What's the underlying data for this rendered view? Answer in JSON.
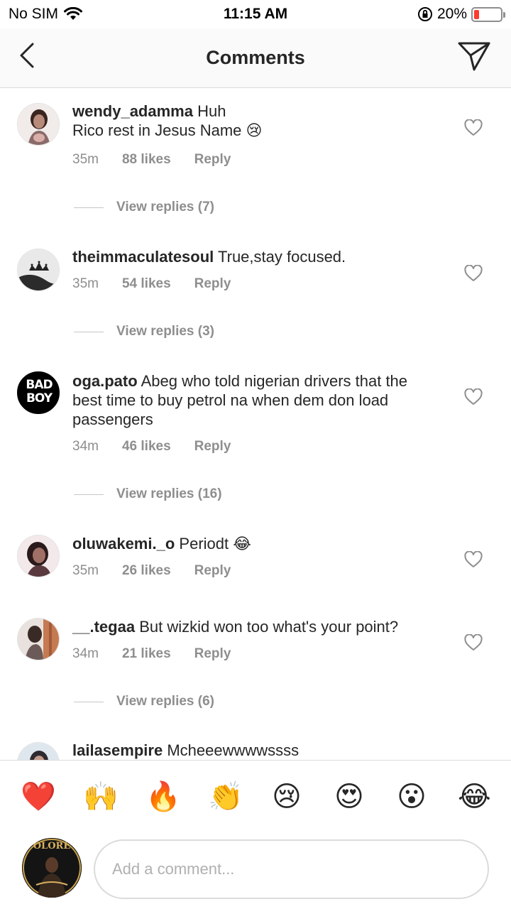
{
  "status_bar": {
    "carrier": "No SIM",
    "time": "11:15 AM",
    "battery_percent": "20%",
    "battery_level": 0.2
  },
  "header": {
    "title": "Comments"
  },
  "comments": [
    {
      "username": "wendy_adamma",
      "text": "Huh\nRico rest in Jesus Name",
      "emoji": "😢",
      "time": "35m",
      "likes": "88 likes",
      "reply": "Reply",
      "view_replies": "View replies (7)"
    },
    {
      "username": "theimmaculatesoul",
      "text": "True,stay focused.",
      "emoji": "",
      "time": "35m",
      "likes": "54 likes",
      "reply": "Reply",
      "view_replies": "View replies (3)"
    },
    {
      "username": "oga.pato",
      "text": "Abeg who told nigerian drivers that the best time to buy petrol na when dem don load passengers",
      "emoji": "",
      "time": "34m",
      "likes": "46 likes",
      "reply": "Reply",
      "view_replies": "View replies (16)"
    },
    {
      "username": "oluwakemi._o",
      "text": "Periodt",
      "emoji": "😂",
      "time": "35m",
      "likes": "26 likes",
      "reply": "Reply",
      "view_replies": ""
    },
    {
      "username": "__.tegaa",
      "text": "But wizkid won too what's your point?",
      "emoji": "",
      "time": "34m",
      "likes": "21 likes",
      "reply": "Reply",
      "view_replies": "View replies (6)"
    },
    {
      "username": "lailasempire",
      "text": "Mcheeewwwwssss",
      "emoji": "",
      "time": "",
      "likes": "",
      "reply": "",
      "view_replies": ""
    }
  ],
  "avatar_badges": {
    "bad_boy_line1": "BAD",
    "bad_boy_line2": "BOY",
    "my_avatar_text": "OLORE"
  },
  "reactions": [
    "❤️",
    "🙌",
    "🔥",
    "👏",
    "😢",
    "😍",
    "😮",
    "😂"
  ],
  "composer": {
    "placeholder": "Add a comment..."
  },
  "colors": {
    "text": "#262626",
    "meta": "#8e8e8e",
    "battery_low": "#ff3b30"
  }
}
